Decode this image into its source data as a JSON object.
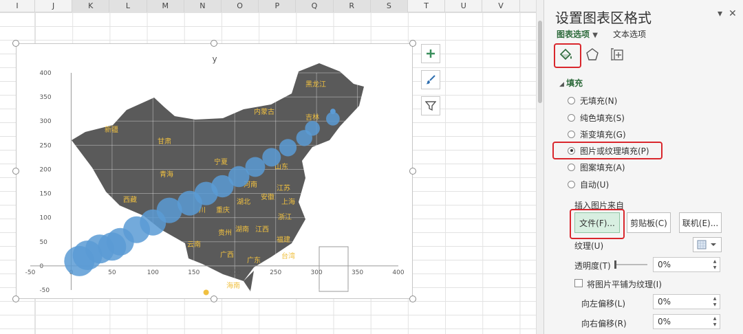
{
  "sheet": {
    "columns": [
      "I",
      "J",
      "K",
      "L",
      "M",
      "N",
      "O",
      "P",
      "Q",
      "R",
      "S",
      "T",
      "U",
      "V"
    ],
    "selected_columns": [
      "K",
      "L",
      "M",
      "N",
      "O",
      "P",
      "Q",
      "R",
      "S"
    ]
  },
  "chart": {
    "side_buttons": [
      {
        "name": "chart-elements-button",
        "icon": "plus-icon"
      },
      {
        "name": "chart-styles-button",
        "icon": "brush-icon"
      },
      {
        "name": "chart-filters-button",
        "icon": "filter-icon"
      }
    ]
  },
  "chart_data": {
    "type": "scatter",
    "title": "y",
    "xlim": [
      -50,
      400
    ],
    "ylim": [
      -50,
      400
    ],
    "x_ticks": [
      "-50",
      "0",
      "50",
      "100",
      "150",
      "200",
      "250",
      "300",
      "350",
      "400"
    ],
    "y_ticks": [
      "-50",
      "0",
      "50",
      "100",
      "150",
      "200",
      "250",
      "300",
      "350",
      "400"
    ],
    "grid": true,
    "background_fill": "picture (China map)",
    "map_labels": [
      "黑龙江",
      "内蒙古",
      "吉林",
      "新疆",
      "甘肃",
      "宁夏",
      "山东",
      "青海",
      "河南",
      "江苏",
      "西藏",
      "湖北",
      "安徽",
      "上海",
      "川",
      "重庆",
      "浙江",
      "湖南",
      "江西",
      "贵州",
      "福建",
      "云南",
      "广西",
      "广东",
      "台湾",
      "海南"
    ],
    "series": [
      {
        "type": "bubble",
        "color": "#5b9bd5",
        "points": [
          {
            "x": 10,
            "y": 10
          },
          {
            "x": 20,
            "y": 22
          },
          {
            "x": 35,
            "y": 35
          },
          {
            "x": 50,
            "y": 40
          },
          {
            "x": 60,
            "y": 50
          },
          {
            "x": 80,
            "y": 75
          },
          {
            "x": 100,
            "y": 90
          },
          {
            "x": 120,
            "y": 115
          },
          {
            "x": 145,
            "y": 130
          },
          {
            "x": 165,
            "y": 150
          },
          {
            "x": 185,
            "y": 165
          },
          {
            "x": 205,
            "y": 185
          },
          {
            "x": 225,
            "y": 205
          },
          {
            "x": 245,
            "y": 225
          },
          {
            "x": 265,
            "y": 245
          },
          {
            "x": 285,
            "y": 265
          },
          {
            "x": 295,
            "y": 285
          },
          {
            "x": 320,
            "y": 305
          }
        ]
      }
    ]
  },
  "panel": {
    "title": "设置图表区格式",
    "tabs": [
      "图表选项",
      "文本选项"
    ],
    "section": "填充",
    "fill_options": [
      {
        "label": "无填充(N)",
        "selected": false
      },
      {
        "label": "纯色填充(S)",
        "selected": false
      },
      {
        "label": "渐变填充(G)",
        "selected": false
      },
      {
        "label": "图片或纹理填充(P)",
        "selected": true
      },
      {
        "label": "图案填充(A)",
        "selected": false
      },
      {
        "label": "自动(U)",
        "selected": false
      }
    ],
    "insert_from": "插入图片来自",
    "file_button": "文件(F)...",
    "clipboard_button": "剪贴板(C)",
    "online_button": "联机(E)...",
    "texture_label": "纹理(U)",
    "transparency_label": "透明度(T)",
    "transparency_value": "0%",
    "tile_label": "将图片平铺为纹理(I)",
    "offset_left_label": "向左偏移(L)",
    "offset_left_value": "0%",
    "offset_right_label": "向右偏移(R)",
    "offset_right_value": "0%"
  },
  "colors": {
    "accent_green": "#2e6b3c",
    "highlight_red": "#d9262c",
    "bubble_blue": "#5b9bd5",
    "map_gray": "#5a5a5a",
    "province_label_yellow": "#f0c040"
  }
}
